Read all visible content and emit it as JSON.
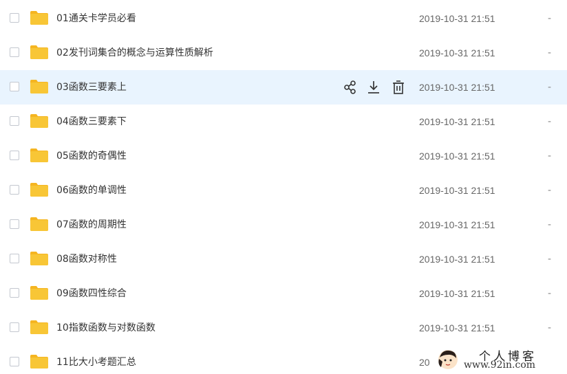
{
  "files": [
    {
      "name": "01通关卡学员必看",
      "time": "2019-10-31 21:51",
      "size": "-"
    },
    {
      "name": "02发刊词集合的概念与运算性质解析",
      "time": "2019-10-31 21:51",
      "size": "-"
    },
    {
      "name": "03函数三要素上",
      "time": "2019-10-31 21:51",
      "size": "-"
    },
    {
      "name": "04函数三要素下",
      "time": "2019-10-31 21:51",
      "size": "-"
    },
    {
      "name": "05函数的奇偶性",
      "time": "2019-10-31 21:51",
      "size": "-"
    },
    {
      "name": "06函数的单调性",
      "time": "2019-10-31 21:51",
      "size": "-"
    },
    {
      "name": "07函数的周期性",
      "time": "2019-10-31 21:51",
      "size": "-"
    },
    {
      "name": "08函数对称性",
      "time": "2019-10-31 21:51",
      "size": "-"
    },
    {
      "name": "09函数四性综合",
      "time": "2019-10-31 21:51",
      "size": "-"
    },
    {
      "name": "10指数函数与对数函数",
      "time": "2019-10-31 21:51",
      "size": "-"
    },
    {
      "name": "11比大小考题汇总",
      "time": "20",
      "size": ""
    }
  ],
  "hovered_row": 2,
  "row_actions": [
    "share-icon",
    "download-icon",
    "delete-icon"
  ],
  "watermark": {
    "title": "个人博客",
    "url": "www.92in.com"
  },
  "colors": {
    "hover_bg": "#e9f4fe",
    "folder": "#f8c636",
    "folder_tab": "#f5b521",
    "icon": "#333333"
  }
}
